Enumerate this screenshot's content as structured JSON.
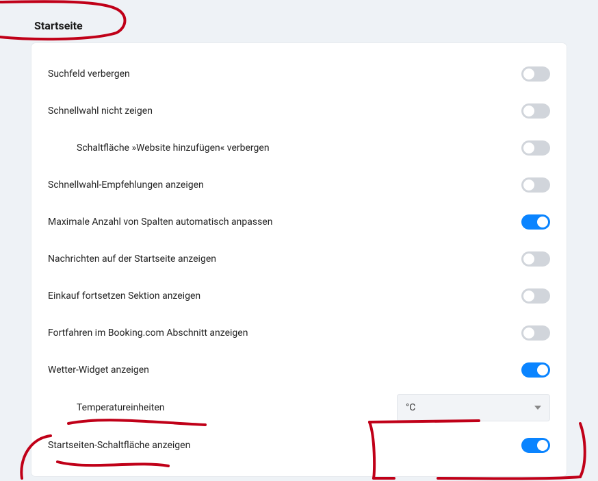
{
  "header": {
    "title": "Startseite"
  },
  "settings": {
    "items": [
      {
        "key": "hide_search",
        "label": "Suchfeld verbergen",
        "on": false,
        "indent": 0
      },
      {
        "key": "hide_speed_dial",
        "label": "Schnellwahl nicht zeigen",
        "on": false,
        "indent": 0
      },
      {
        "key": "hide_add_site",
        "label": "Schaltfläche »Website hinzufügen« verbergen",
        "on": false,
        "indent": 1
      },
      {
        "key": "show_recs",
        "label": "Schnellwahl-Empfehlungen anzeigen",
        "on": false,
        "indent": 0
      },
      {
        "key": "auto_columns",
        "label": "Maximale Anzahl von Spalten automatisch anpassen",
        "on": true,
        "indent": 0
      },
      {
        "key": "show_news",
        "label": "Nachrichten auf der Startseite anzeigen",
        "on": false,
        "indent": 0
      },
      {
        "key": "continue_shopping",
        "label": "Einkauf fortsetzen Sektion anzeigen",
        "on": false,
        "indent": 0
      },
      {
        "key": "continue_booking",
        "label": "Fortfahren im Booking.com Abschnitt anzeigen",
        "on": false,
        "indent": 0
      },
      {
        "key": "show_weather",
        "label": "Wetter-Widget anzeigen",
        "on": true,
        "indent": 0
      }
    ],
    "temperature": {
      "label": "Temperatureinheiten",
      "value": "°C"
    },
    "show_home_button": {
      "label": "Startseiten-Schaltfläche anzeigen",
      "on": true
    }
  },
  "annotation_color": "#c00018"
}
